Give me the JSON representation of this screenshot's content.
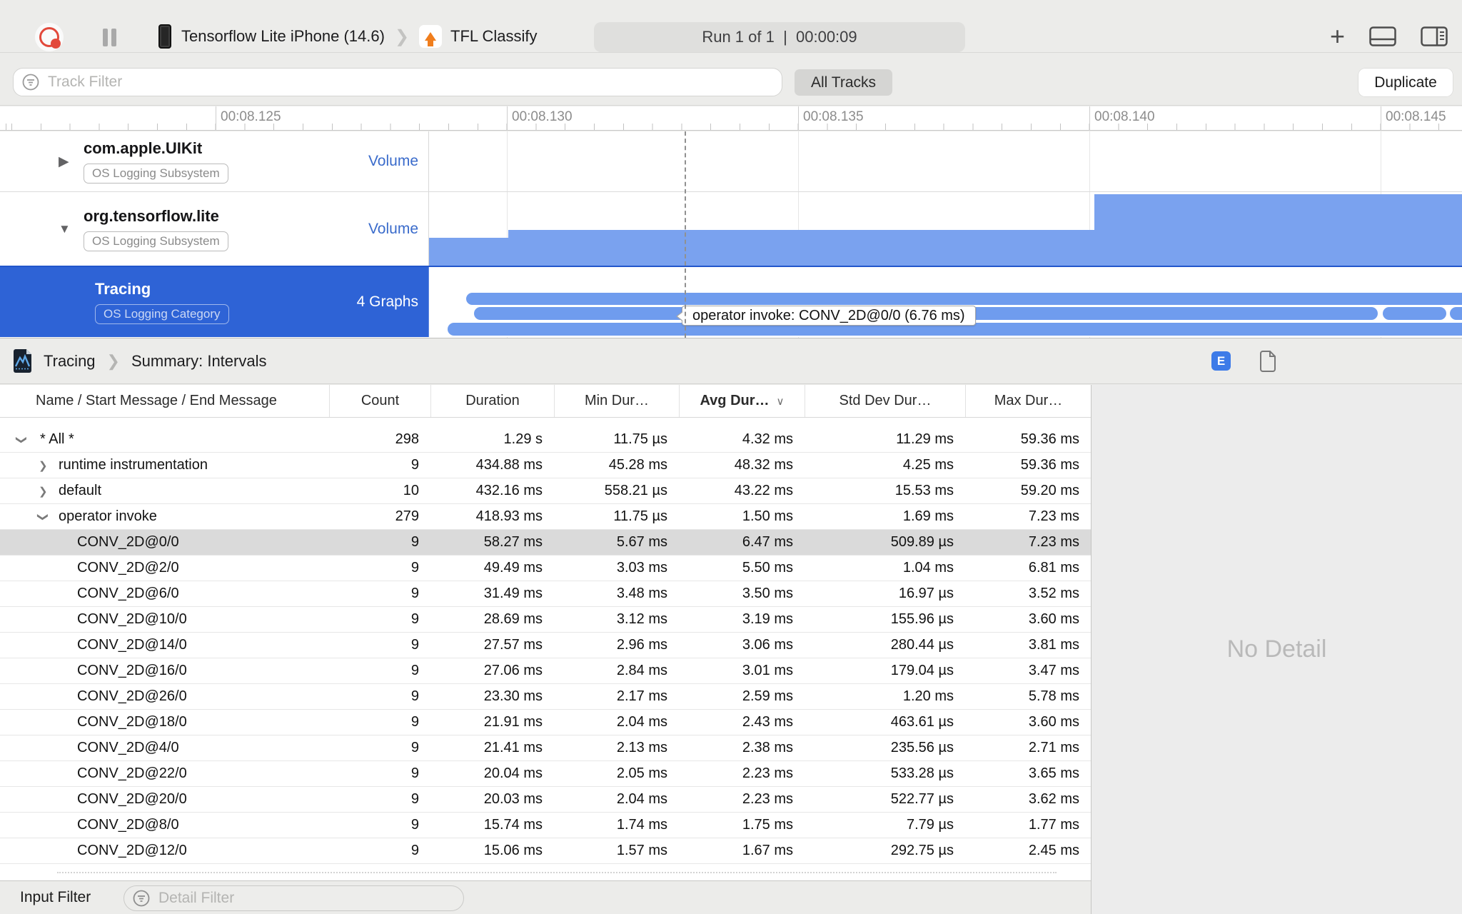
{
  "toolbar": {
    "device_name": "Tensorflow Lite iPhone (14.6)",
    "process_name": "TFL Classify",
    "run_status": "Run 1 of 1  |  00:00:09"
  },
  "track_filter": {
    "placeholder": "Track Filter",
    "all_tracks_label": "All Tracks",
    "duplicate_label": "Duplicate"
  },
  "ruler": {
    "labels": [
      "00:08.125",
      "00:08.130",
      "00:08.135",
      "00:08.140",
      "00:08.145"
    ]
  },
  "tracks": [
    {
      "title": "com.apple.UIKit",
      "badge": "OS Logging Subsystem",
      "meta": "Volume",
      "disclosure": "collapsed"
    },
    {
      "title": "org.tensorflow.lite",
      "badge": "OS Logging Subsystem",
      "meta": "Volume",
      "disclosure": "expanded"
    },
    {
      "title": "Tracing",
      "badge": "OS Logging Category",
      "meta": "4 Graphs",
      "selected": true
    }
  ],
  "timeline_tooltip": "operator invoke: CONV_2D@0/0 (6.76 ms)",
  "detail": {
    "breadcrumb_instrument": "Tracing",
    "breadcrumb_page": "Summary: Intervals",
    "extended_detail_button": "E",
    "no_detail_text": "No Detail",
    "input_filter_label": "Input Filter",
    "detail_filter_placeholder": "Detail Filter"
  },
  "icons": {
    "triangle_collapsed": "▶",
    "triangle_expanded": "▼",
    "breadcrumb_chevron": "❯",
    "sort_chevron": "∨",
    "disclosure_chevron": "❯",
    "plus": "+"
  },
  "table": {
    "columns": [
      "Name / Start Message / End Message",
      "Count",
      "Duration",
      "Min Dur…",
      "Avg Dur…",
      "Std Dev Dur…",
      "Max Dur…"
    ],
    "sorted_column": "Avg Dur…",
    "rows": [
      {
        "name": "* All *",
        "depth": 0,
        "disclosure": "expanded",
        "selected": false,
        "values": [
          "298",
          "1.29 s",
          "11.75 µs",
          "4.32 ms",
          "11.29 ms",
          "59.36 ms"
        ]
      },
      {
        "name": "runtime instrumentation",
        "depth": 1,
        "disclosure": "collapsed",
        "selected": false,
        "values": [
          "9",
          "434.88 ms",
          "45.28 ms",
          "48.32 ms",
          "4.25 ms",
          "59.36 ms"
        ]
      },
      {
        "name": "default",
        "depth": 1,
        "disclosure": "collapsed",
        "selected": false,
        "values": [
          "10",
          "432.16 ms",
          "558.21 µs",
          "43.22 ms",
          "15.53 ms",
          "59.20 ms"
        ]
      },
      {
        "name": "operator invoke",
        "depth": 1,
        "disclosure": "expanded",
        "selected": false,
        "values": [
          "279",
          "418.93 ms",
          "11.75 µs",
          "1.50 ms",
          "1.69 ms",
          "7.23 ms"
        ]
      },
      {
        "name": "CONV_2D@0/0",
        "depth": 2,
        "disclosure": null,
        "selected": true,
        "values": [
          "9",
          "58.27 ms",
          "5.67 ms",
          "6.47 ms",
          "509.89 µs",
          "7.23 ms"
        ]
      },
      {
        "name": "CONV_2D@2/0",
        "depth": 2,
        "disclosure": null,
        "selected": false,
        "values": [
          "9",
          "49.49 ms",
          "3.03 ms",
          "5.50 ms",
          "1.04 ms",
          "6.81 ms"
        ]
      },
      {
        "name": "CONV_2D@6/0",
        "depth": 2,
        "disclosure": null,
        "selected": false,
        "values": [
          "9",
          "31.49 ms",
          "3.48 ms",
          "3.50 ms",
          "16.97 µs",
          "3.52 ms"
        ]
      },
      {
        "name": "CONV_2D@10/0",
        "depth": 2,
        "disclosure": null,
        "selected": false,
        "values": [
          "9",
          "28.69 ms",
          "3.12 ms",
          "3.19 ms",
          "155.96 µs",
          "3.60 ms"
        ]
      },
      {
        "name": "CONV_2D@14/0",
        "depth": 2,
        "disclosure": null,
        "selected": false,
        "values": [
          "9",
          "27.57 ms",
          "2.96 ms",
          "3.06 ms",
          "280.44 µs",
          "3.81 ms"
        ]
      },
      {
        "name": "CONV_2D@16/0",
        "depth": 2,
        "disclosure": null,
        "selected": false,
        "values": [
          "9",
          "27.06 ms",
          "2.84 ms",
          "3.01 ms",
          "179.04 µs",
          "3.47 ms"
        ]
      },
      {
        "name": "CONV_2D@26/0",
        "depth": 2,
        "disclosure": null,
        "selected": false,
        "values": [
          "9",
          "23.30 ms",
          "2.17 ms",
          "2.59 ms",
          "1.20 ms",
          "5.78 ms"
        ]
      },
      {
        "name": "CONV_2D@18/0",
        "depth": 2,
        "disclosure": null,
        "selected": false,
        "values": [
          "9",
          "21.91 ms",
          "2.04 ms",
          "2.43 ms",
          "463.61 µs",
          "3.60 ms"
        ]
      },
      {
        "name": "CONV_2D@4/0",
        "depth": 2,
        "disclosure": null,
        "selected": false,
        "values": [
          "9",
          "21.41 ms",
          "2.13 ms",
          "2.38 ms",
          "235.56 µs",
          "2.71 ms"
        ]
      },
      {
        "name": "CONV_2D@22/0",
        "depth": 2,
        "disclosure": null,
        "selected": false,
        "values": [
          "9",
          "20.04 ms",
          "2.05 ms",
          "2.23 ms",
          "533.28 µs",
          "3.65 ms"
        ]
      },
      {
        "name": "CONV_2D@20/0",
        "depth": 2,
        "disclosure": null,
        "selected": false,
        "values": [
          "9",
          "20.03 ms",
          "2.04 ms",
          "2.23 ms",
          "522.77 µs",
          "3.62 ms"
        ]
      },
      {
        "name": "CONV_2D@8/0",
        "depth": 2,
        "disclosure": null,
        "selected": false,
        "values": [
          "9",
          "15.74 ms",
          "1.74 ms",
          "1.75 ms",
          "7.79 µs",
          "1.77 ms"
        ]
      },
      {
        "name": "CONV_2D@12/0",
        "depth": 2,
        "disclosure": null,
        "selected": false,
        "values": [
          "9",
          "15.06 ms",
          "1.57 ms",
          "1.67 ms",
          "292.75 µs",
          "2.45 ms"
        ]
      }
    ]
  },
  "colors": {
    "selection_blue": "#2E63D6",
    "bar_blue": "#7AA2EF",
    "record_red": "#E2493B",
    "extended_detail_blue": "#3D7BE8",
    "volume_label_blue": "#3A6BCB"
  }
}
